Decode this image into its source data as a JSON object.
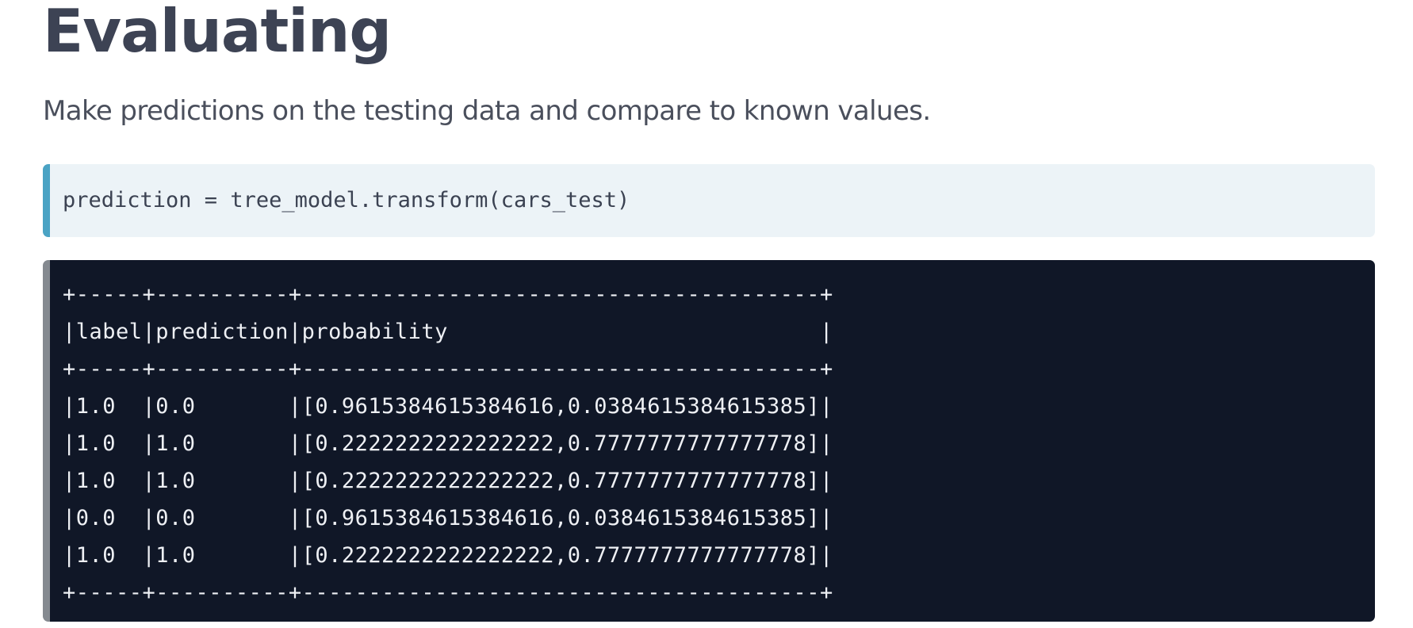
{
  "section": {
    "title": "Evaluating",
    "description": "Make predictions on the testing data and compare to known values."
  },
  "input_cell": {
    "code": "prediction = tree_model.transform(cars_test)"
  },
  "output_cell": {
    "lines": [
      "+-----+----------+---------------------------------------+",
      "|label|prediction|probability                            |",
      "+-----+----------+---------------------------------------+",
      "|1.0  |0.0       |[0.9615384615384616,0.0384615384615385]|",
      "|1.0  |1.0       |[0.2222222222222222,0.7777777777777778]|",
      "|1.0  |1.0       |[0.2222222222222222,0.7777777777777778]|",
      "|0.0  |0.0       |[0.9615384615384616,0.0384615384615385]|",
      "|1.0  |1.0       |[0.2222222222222222,0.7777777777777778]|",
      "+-----+----------+---------------------------------------+"
    ]
  },
  "colors": {
    "heading": "#3d4354",
    "input_background": "#ecf3f7",
    "input_accent": "#4aa3c4",
    "output_background": "#101727",
    "output_accent": "#858a90",
    "output_text": "#eef0f4"
  }
}
